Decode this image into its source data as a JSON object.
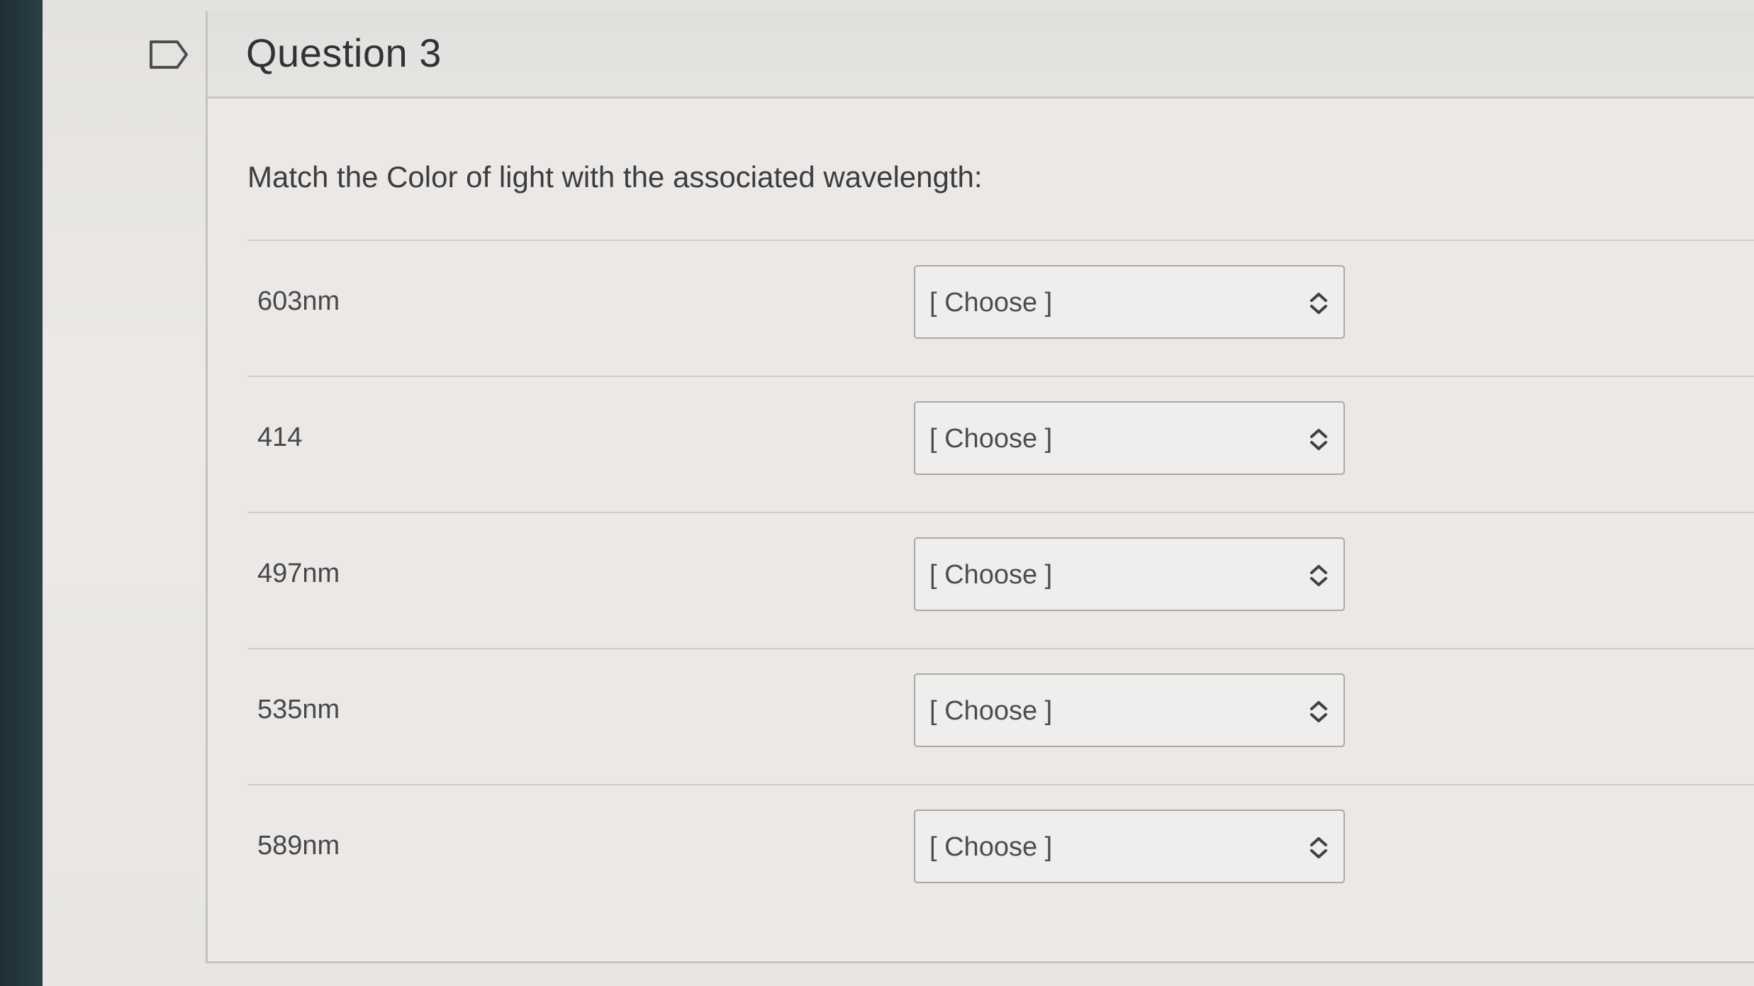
{
  "question": {
    "title": "Question 3",
    "prompt": "Match the Color of light with the associated wavelength:"
  },
  "rows": [
    {
      "label": "603nm",
      "selected": "[ Choose ]"
    },
    {
      "label": "414",
      "selected": "[ Choose ]"
    },
    {
      "label": "497nm",
      "selected": "[ Choose ]"
    },
    {
      "label": "535nm",
      "selected": "[ Choose ]"
    },
    {
      "label": "589nm",
      "selected": "[ Choose ]"
    }
  ],
  "icons": {
    "flag": "flag-outline-icon",
    "select_arrow": "chevron-up-down-icon"
  },
  "colors": {
    "text": "#3b3e42",
    "border": "#a9a9a9",
    "background": "#e9e6e3"
  }
}
